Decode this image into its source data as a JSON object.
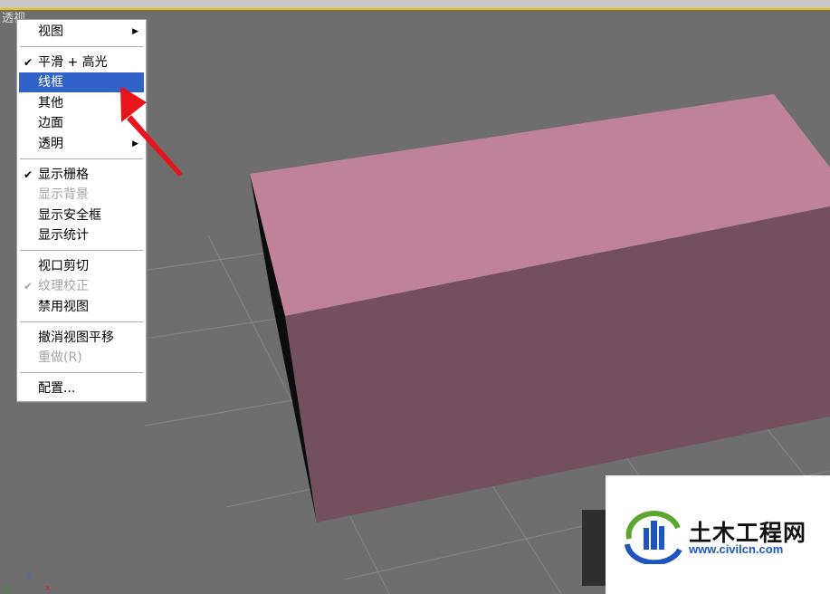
{
  "viewport": {
    "label": "透视"
  },
  "menu": {
    "items": [
      {
        "label": "视图",
        "checked": false,
        "disabled": false,
        "submenu": true,
        "selected": false
      },
      {
        "label": "平滑 + 高光",
        "checked": true,
        "disabled": false,
        "submenu": false,
        "selected": false
      },
      {
        "label": "线框",
        "checked": false,
        "disabled": false,
        "submenu": true,
        "selected": true
      },
      {
        "label": "其他",
        "checked": false,
        "disabled": false,
        "submenu": true,
        "selected": false
      },
      {
        "label": "边面",
        "checked": false,
        "disabled": false,
        "submenu": false,
        "selected": false
      },
      {
        "label": "透明",
        "checked": false,
        "disabled": false,
        "submenu": true,
        "selected": false
      },
      {
        "label": "显示栅格",
        "checked": true,
        "disabled": false,
        "submenu": false,
        "selected": false
      },
      {
        "label": "显示背景",
        "checked": false,
        "disabled": true,
        "submenu": false,
        "selected": false
      },
      {
        "label": "显示安全框",
        "checked": false,
        "disabled": false,
        "submenu": false,
        "selected": false
      },
      {
        "label": "显示统计",
        "checked": false,
        "disabled": false,
        "submenu": false,
        "selected": false
      },
      {
        "label": "视口剪切",
        "checked": false,
        "disabled": false,
        "submenu": false,
        "selected": false
      },
      {
        "label": "纹理校正",
        "checked": true,
        "disabled": true,
        "submenu": false,
        "selected": false
      },
      {
        "label": "禁用视图",
        "checked": false,
        "disabled": false,
        "submenu": false,
        "selected": false
      },
      {
        "label": "撤消视图平移",
        "checked": false,
        "disabled": false,
        "submenu": false,
        "selected": false
      },
      {
        "label": "重做(R)",
        "checked": false,
        "disabled": true,
        "submenu": false,
        "selected": false
      },
      {
        "label": "配置...",
        "checked": false,
        "disabled": false,
        "submenu": false,
        "selected": false
      }
    ],
    "check_glyph": "✔",
    "submenu_glyph": "▶"
  },
  "axis": {
    "z": "z",
    "y": "y",
    "x": "x"
  },
  "watermark": {
    "title": "土木工程网",
    "url": "www.civilcn.com"
  },
  "colors": {
    "box_top": "#c0829a",
    "box_front": "#744f5e",
    "box_side": "#0c0c0c",
    "grid": "#858585",
    "menu_highlight": "#3162c8",
    "annotation_arrow": "#e8141c"
  }
}
